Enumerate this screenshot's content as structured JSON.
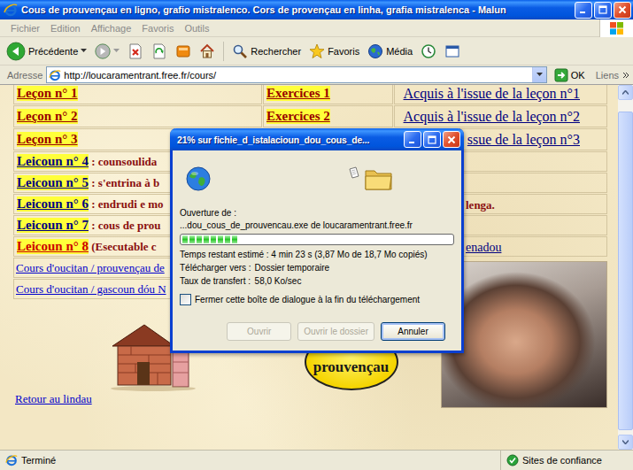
{
  "window": {
    "title": "Cous de prouvençau en ligno, grafio mistralenco. Cors de provençau en linha, grafia mistralenca - Malun"
  },
  "menu": [
    {
      "label": "Fichier",
      "disabled": true
    },
    {
      "label": "Edition",
      "disabled": true
    },
    {
      "label": "Affichage",
      "disabled": true
    },
    {
      "label": "Favoris",
      "disabled": true
    },
    {
      "label": "Outils",
      "disabled": true
    }
  ],
  "toolbar": {
    "back": "Précédente",
    "search": "Rechercher",
    "favorites": "Favoris",
    "media": "Média"
  },
  "address": {
    "label": "Adresse",
    "url": "http://loucaramentrant.free.fr/cours/",
    "go": "OK",
    "links": "Liens"
  },
  "page": {
    "lessons": [
      {
        "lesson": "Leçon n° 1",
        "exercise": "Exercices 1",
        "acquis": "Acquis à l'issue de la leçon n°1"
      },
      {
        "lesson": "Leçon n° 2",
        "exercise": "Exercices 2",
        "acquis": "Acquis à l'issue de la leçon n°2"
      },
      {
        "lesson": "Leçon n° 3",
        "acquis": "ssue de la leçon n°3"
      }
    ],
    "lessons_more": [
      {
        "lesson": "Leicoun n° 4",
        "description": " : counsoulida",
        "color": "#000080"
      },
      {
        "lesson": "Leicoun n° 5",
        "description": " : s'entrina à b",
        "color": "#000080"
      },
      {
        "lesson": "Leicoun n° 6",
        "description": " : endrudi e mo",
        "color": "#000080",
        "right": {
          "text": "lenga.",
          "kind": "plain"
        }
      },
      {
        "lesson": "Leicoun n° 7",
        "description": " : cous de prou",
        "color": "#000080"
      },
      {
        "lesson": "Leicoun n° 8",
        "description": " (Esecutable c",
        "color": "#cc0000",
        "right": {
          "text": "enadou",
          "kind": "link"
        }
      }
    ],
    "courses": [
      "Cours d'oucitan / prouvençau de",
      "Cours d'oucitan / gascoun dóu N"
    ],
    "home_link": "Retour au lindau",
    "logo": {
      "text": "prouvençau"
    }
  },
  "dialog": {
    "title": "21% sur fichie_d_istalacioun_dou_cous_de...",
    "opening_label": "Ouverture de :",
    "file": "...dou_cous_de_prouvencau.exe de loucaramentrant.free.fr",
    "level": 0.21,
    "time_left": "Temps restant estimé : 4 min 23 s (3,87 Mo de 18,7 Mo copiés)",
    "fields": [
      {
        "label": "Télécharger vers :",
        "value": "Dossier temporaire"
      },
      {
        "label": "Taux de transfert :",
        "value": "58,0 Ko/sec"
      }
    ],
    "close_when_done": {
      "label": "Fermer cette boîte de dialogue à la fin du téléchargement",
      "checked": false
    },
    "buttons": [
      {
        "label": "Ouvrir",
        "disabled": true,
        "default": false
      },
      {
        "label": "Ouvrir le dossier",
        "disabled": true,
        "default": false
      },
      {
        "label": "Annuler",
        "disabled": false,
        "default": true
      }
    ]
  },
  "status_bar": {
    "text": "Terminé",
    "zone": "Sites de confiance"
  }
}
